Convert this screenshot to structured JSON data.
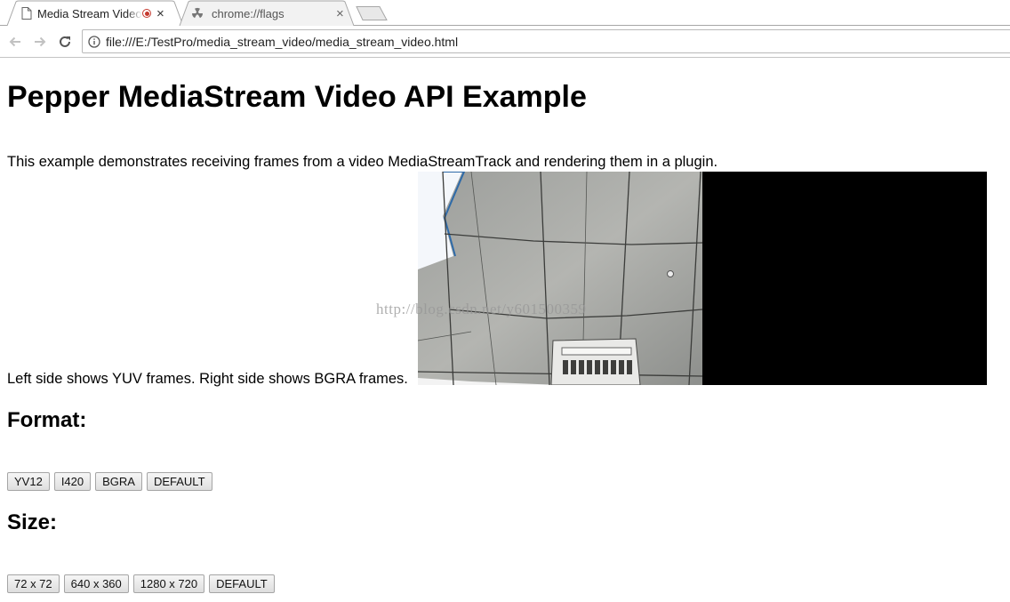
{
  "browser": {
    "tabs": [
      {
        "title": "Media Stream Video",
        "icon": "page-icon",
        "recording": true,
        "active": true
      },
      {
        "title": "chrome://flags",
        "icon": "radiation-icon",
        "active": false
      }
    ],
    "close_glyph": "×",
    "url": "file:///E:/TestPro/media_stream_video/media_stream_video.html"
  },
  "page": {
    "title": "Pepper MediaStream Video API Example",
    "description": "This example demonstrates receiving frames from a video MediaStreamTrack and rendering them in a plugin.",
    "caption": "Left side shows YUV frames. Right side shows BGRA frames.",
    "watermark": "http://blog.csdn.net/y601500359",
    "format": {
      "heading": "Format:",
      "buttons": [
        "YV12",
        "I420",
        "BGRA",
        "DEFAULT"
      ]
    },
    "size": {
      "heading": "Size:",
      "buttons": [
        "72 x 72",
        "640 x 360",
        "1280 x 720",
        "DEFAULT"
      ]
    }
  },
  "colors": {
    "recording": "#c53a2f",
    "bgra_frame": "#000000",
    "ceiling_tile": "#a8a9a5"
  }
}
